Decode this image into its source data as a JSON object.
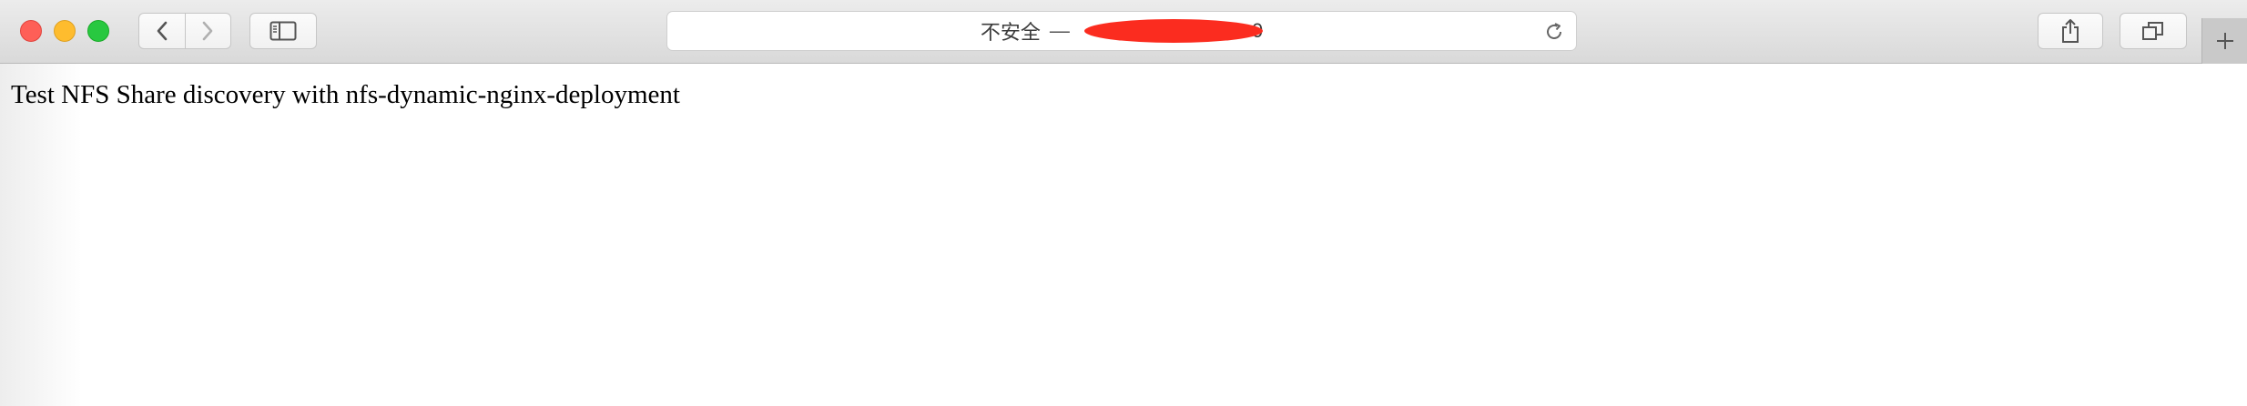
{
  "window": {
    "address_bar": {
      "security_label": "不安全",
      "separator": "—",
      "url_visible_fragment": "0",
      "url_redacted": true
    }
  },
  "page": {
    "body_text": "Test NFS Share discovery with nfs-dynamic-nginx-deployment"
  },
  "colors": {
    "close": "#fe5f57",
    "minimize": "#febc2e",
    "maximize": "#28c840",
    "redaction": "#fb2c1f"
  },
  "icons": {
    "back": "chevron-left-icon",
    "forward": "chevron-right-icon",
    "sidebar": "sidebar-icon",
    "reload": "reload-icon",
    "share": "share-icon",
    "tabs": "tab-overview-icon",
    "new_tab": "plus-icon"
  }
}
